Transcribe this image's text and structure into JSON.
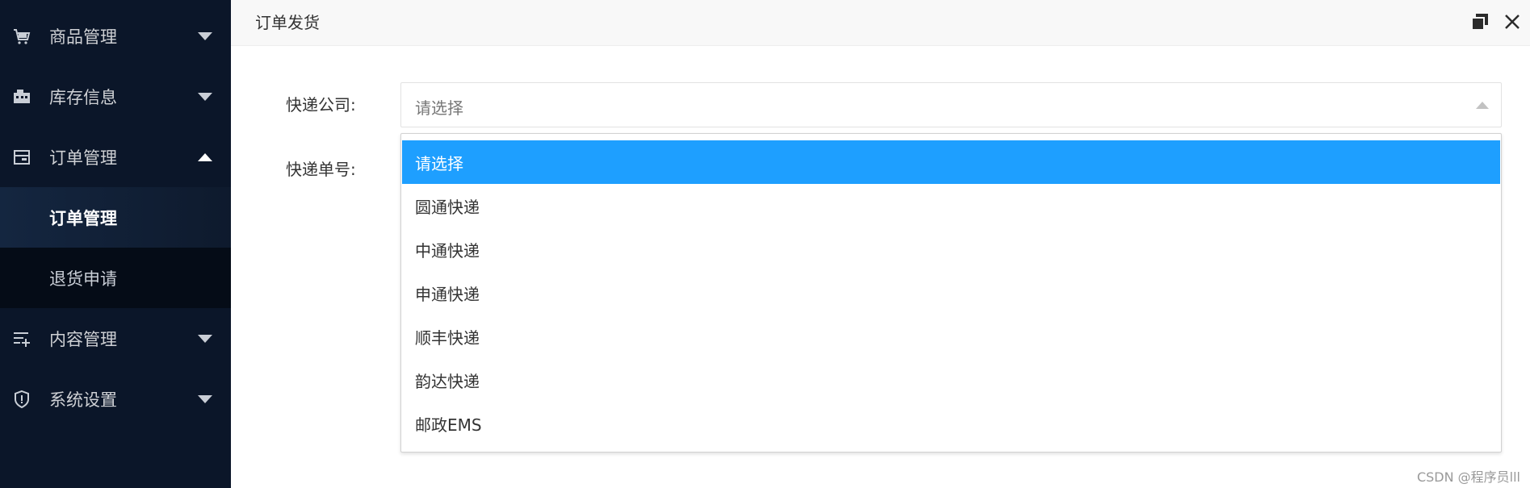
{
  "sidebar": {
    "items": [
      {
        "label": "商品管理",
        "icon": "cart-icon",
        "expanded": false
      },
      {
        "label": "库存信息",
        "icon": "warehouse-icon",
        "expanded": false
      },
      {
        "label": "订单管理",
        "icon": "order-icon",
        "expanded": true
      },
      {
        "label": "内容管理",
        "icon": "list-edit-icon",
        "expanded": false
      },
      {
        "label": "系统设置",
        "icon": "shield-icon",
        "expanded": false
      }
    ],
    "subitems": [
      {
        "label": "订单管理",
        "active": true
      },
      {
        "label": "退货申请",
        "active": false
      }
    ]
  },
  "dialog": {
    "title": "订单发货",
    "maximize_icon": "restore-icon",
    "close_icon": "close-icon"
  },
  "form": {
    "courier_label": "快递公司:",
    "tracking_label": "快递单号:",
    "courier_selected": "请选择"
  },
  "dropdown": {
    "options": [
      "请选择",
      "圆通快递",
      "中通快递",
      "申通快递",
      "顺丰快递",
      "韵达快递",
      "邮政EMS"
    ],
    "selected_index": 0
  },
  "colors": {
    "sidebar_bg": "#0b1629",
    "accent": "#1e9fff"
  },
  "watermark": "CSDN @程序员lll"
}
